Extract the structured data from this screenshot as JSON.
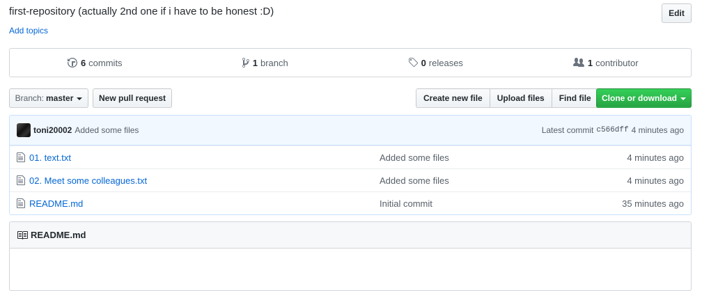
{
  "repo": {
    "description": "first-repository (actually 2nd one if i have to be honest :D)",
    "add_topics": "Add topics",
    "edit_label": "Edit"
  },
  "summary": {
    "commits": {
      "count": "6",
      "label": "commits",
      "icon": "history-icon"
    },
    "branches": {
      "count": "1",
      "label": "branch",
      "icon": "git-branch-icon"
    },
    "releases": {
      "count": "0",
      "label": "releases",
      "icon": "tag-icon"
    },
    "contributors": {
      "count": "1",
      "label": "contributor",
      "icon": "people-icon"
    }
  },
  "toolbar": {
    "branch_prefix": "Branch:",
    "branch_name": "master",
    "new_pull_request": "New pull request",
    "create_new_file": "Create new file",
    "upload_files": "Upload files",
    "find_file": "Find file",
    "clone_or_download": "Clone or download"
  },
  "latest_commit": {
    "author": "toni20002",
    "message": "Added some files",
    "prefix": "Latest commit",
    "sha": "c566dff",
    "age": "4 minutes ago"
  },
  "files": [
    {
      "name": "01. text.txt",
      "message": "Added some files",
      "age": "4 minutes ago",
      "icon": "file-icon"
    },
    {
      "name": "02. Meet some colleagues.txt",
      "message": "Added some files",
      "age": "4 minutes ago",
      "icon": "file-icon"
    },
    {
      "name": "README.md",
      "message": "Initial commit",
      "age": "35 minutes ago",
      "icon": "file-icon"
    }
  ],
  "readme": {
    "title": "README.md",
    "icon": "book-icon"
  },
  "colors": {
    "link": "#0366d6",
    "clone_button": "#28a745",
    "commit_tease_bg": "#f1f8ff"
  }
}
